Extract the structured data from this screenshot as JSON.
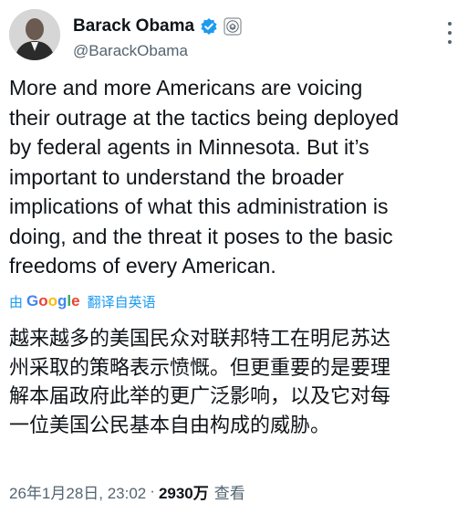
{
  "author": {
    "display_name": "Barack Obama",
    "handle": "@BarackObama",
    "verified_icon": "verified-badge-icon",
    "affiliation_icon": "government-seal-icon"
  },
  "tweet": {
    "text": "More and more Americans are voicing\ntheir outrage at the tactics being deployed\nby federal agents in Minnesota. But it’s\nimportant to understand the broader\nimplications of what this administration is\ndoing, and the threat it poses to the basic\nfreedoms of every American.",
    "translation": {
      "by_label": "由",
      "provider": "Google",
      "link_label": "翻译自英语",
      "text": "越来越多的美国民众对联邦特工在明尼苏达\n州采取的策略表示愤慨。但更重要的是要理\n解本届政府此举的更广泛影响，以及它对每\n一位美国公民基本自由构成的威胁。"
    },
    "timestamp": "26年1月28日, 23:02",
    "separator": "·",
    "views_count": "2930万",
    "views_label": "查看"
  },
  "colors": {
    "text_primary": "#0f1419",
    "text_secondary": "#536471",
    "accent_blue": "#1d9bf0",
    "verified_blue": "#1d9bf0"
  }
}
